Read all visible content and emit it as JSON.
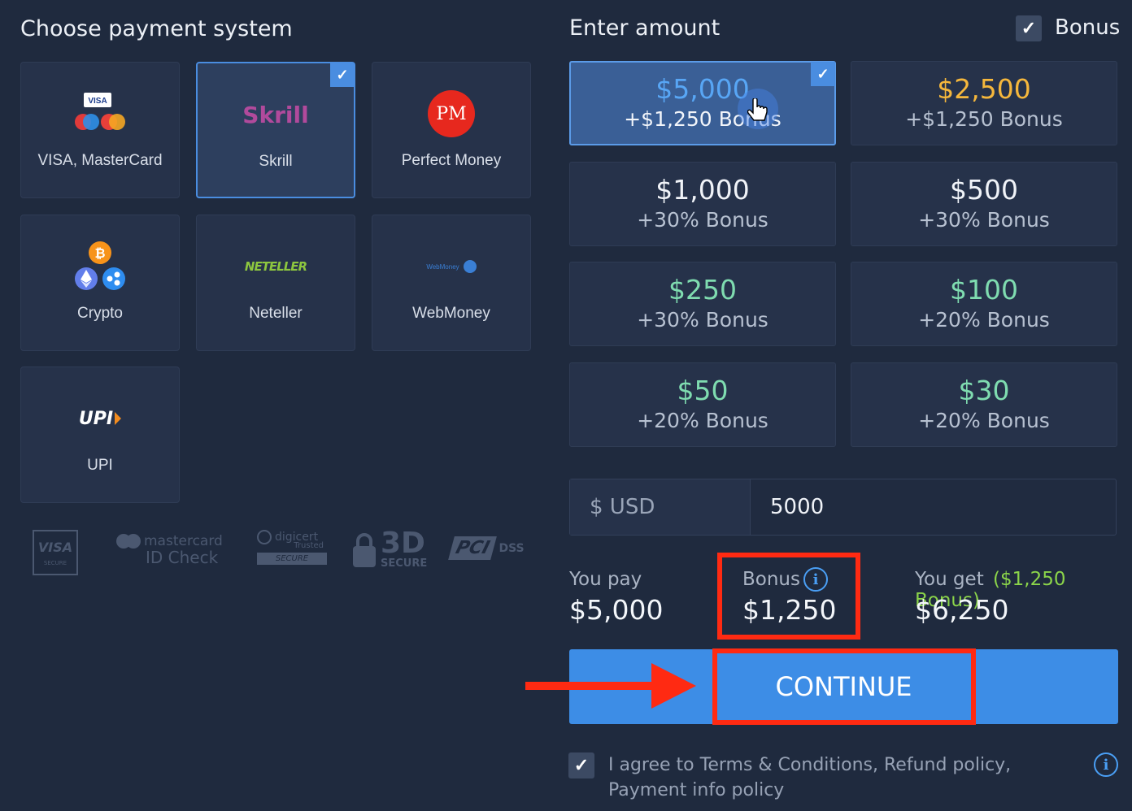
{
  "payment": {
    "title": "Choose payment system",
    "methods": [
      {
        "label": "VISA, MasterCard",
        "selected": false
      },
      {
        "label": "Skrill",
        "selected": true
      },
      {
        "label": "Perfect Money",
        "selected": false
      },
      {
        "label": "Crypto",
        "selected": false
      },
      {
        "label": "Neteller",
        "selected": false
      },
      {
        "label": "WebMoney",
        "selected": false
      },
      {
        "label": "UPI",
        "selected": false
      }
    ],
    "logos": {
      "skrill": "Skrill",
      "pm": "PM",
      "neteller": "NETELLER",
      "webmoney": "WebMoney",
      "upi": "UPI",
      "visa": "VISA"
    },
    "security_seals": {
      "visa_secure": "VISA",
      "visa_secure_sub": "SECURE",
      "mastercard": "mastercard",
      "mastercard_sub": "ID Check",
      "digicert": "digicert",
      "digicert_sub": "Trusted",
      "digicert_badge": "SECURE",
      "three_d": "3D",
      "three_d_sub": "SECURE",
      "pci": "PCI",
      "pci_sub": "DSS"
    }
  },
  "amount": {
    "title": "Enter amount",
    "bonus_toggle_label": "Bonus",
    "bonus_checked": true,
    "options": [
      {
        "value": "$5,000",
        "bonus": "+$1,250 Bonus",
        "selected": true,
        "color": "#58a6f5"
      },
      {
        "value": "$2,500",
        "bonus": "+$1,250 Bonus",
        "selected": false,
        "color": "#f5b73c"
      },
      {
        "value": "$1,000",
        "bonus": "+30% Bonus",
        "selected": false,
        "color": "#f0f3f8"
      },
      {
        "value": "$500",
        "bonus": "+30% Bonus",
        "selected": false,
        "color": "#f0f3f8"
      },
      {
        "value": "$250",
        "bonus": "+30% Bonus",
        "selected": false,
        "color": "#7fdcb0"
      },
      {
        "value": "$100",
        "bonus": "+20% Bonus",
        "selected": false,
        "color": "#7fdcb0"
      },
      {
        "value": "$50",
        "bonus": "+20% Bonus",
        "selected": false,
        "color": "#7fdcb0"
      },
      {
        "value": "$30",
        "bonus": "+20% Bonus",
        "selected": false,
        "color": "#7fdcb0"
      }
    ],
    "currency_label": "$ USD",
    "input_value": "5000"
  },
  "summary": {
    "you_pay_label": "You pay",
    "you_pay_value": "$5,000",
    "bonus_label": "Bonus",
    "bonus_value": "$1,250",
    "you_get_label": "You get",
    "you_get_bonus_note": "($1,250 Bonus)",
    "you_get_value": "$6,250"
  },
  "continue_label": "CONTINUE",
  "terms": {
    "checked": true,
    "text": "I agree to Terms & Conditions, Refund policy, Payment info policy"
  }
}
